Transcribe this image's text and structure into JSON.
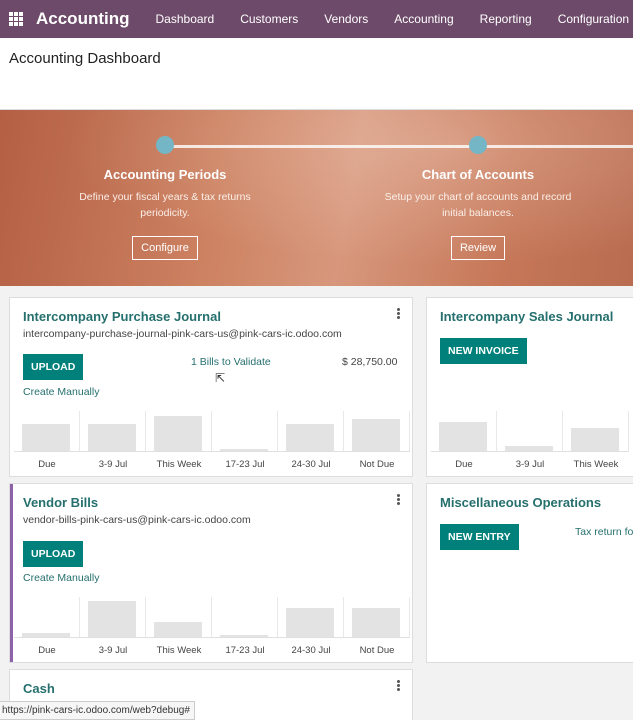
{
  "navbar": {
    "app_icon": "grid-apps-icon",
    "brand": "Accounting",
    "menu": [
      "Dashboard",
      "Customers",
      "Vendors",
      "Accounting",
      "Reporting",
      "Configuration"
    ],
    "color": "#6d4a69"
  },
  "page": {
    "title": "Accounting Dashboard"
  },
  "onboarding": {
    "steps": [
      {
        "title": "Accounting Periods",
        "description": "Define your fiscal years & tax returns periodicity.",
        "button": "Configure"
      },
      {
        "title": "Chart of Accounts",
        "description": "Setup your chart of accounts and record initial balances.",
        "button": "Review"
      }
    ]
  },
  "journals": {
    "intercompany_purchase": {
      "title": "Intercompany Purchase Journal",
      "email": "intercompany-purchase-journal-pink-cars-us@pink-cars-ic.odoo.com",
      "primary_button": "UPLOAD",
      "secondary_link": "Create Manually",
      "stat_label": "1 Bills to Validate",
      "stat_amount": "$ 28,750.00",
      "graph_labels": [
        "Due",
        "3-9 Jul",
        "This Week",
        "17-23 Jul",
        "24-30 Jul",
        "Not Due"
      ],
      "graph_values": [
        0.7,
        0.7,
        0.92,
        0.05,
        0.7,
        0.85
      ]
    },
    "intercompany_sales": {
      "title": "Intercompany Sales Journal",
      "primary_button": "NEW INVOICE",
      "graph_labels": [
        "Due",
        "3-9 Jul",
        "This Week"
      ],
      "graph_values": [
        0.75,
        0.12,
        0.6
      ]
    },
    "vendor_bills": {
      "title": "Vendor Bills",
      "email": "vendor-bills-pink-cars-us@pink-cars-ic.odoo.com",
      "primary_button": "UPLOAD",
      "secondary_link": "Create Manually",
      "graph_labels": [
        "Due",
        "3-9 Jul",
        "This Week",
        "17-23 Jul",
        "24-30 Jul",
        "Not Due"
      ],
      "graph_values": [
        0.1,
        0.95,
        0.4,
        0.05,
        0.75,
        0.75
      ],
      "accent_color": "#8e62a8"
    },
    "misc_operations": {
      "title": "Miscellaneous Operations",
      "primary_button": "NEW ENTRY",
      "side_link": "Tax return fo"
    },
    "cash": {
      "title": "Cash"
    }
  },
  "statusbar": {
    "text": "https://pink-cars-ic.odoo.com/web?debug#"
  }
}
